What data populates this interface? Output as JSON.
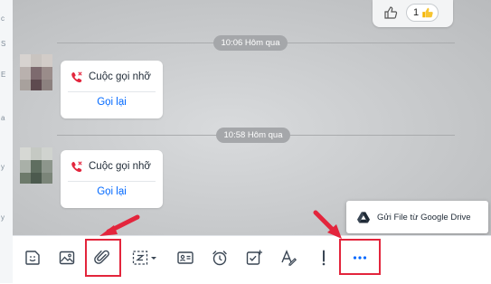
{
  "sidebar": {
    "fragments": [
      "c",
      "S",
      "E",
      "a",
      "y",
      "y"
    ]
  },
  "reaction": {
    "count": "1",
    "icon_outline": "thumbs-up-outline-icon",
    "icon_emoji": "thumbs-up-emoji-icon"
  },
  "timestamps": [
    "10:06 Hôm qua",
    "10:58 Hôm qua"
  ],
  "messages": [
    {
      "type": "missed_call",
      "title": "Cuộc gọi nhỡ",
      "action": "Gọi lại"
    },
    {
      "type": "missed_call",
      "title": "Cuộc gọi nhỡ",
      "action": "Gọi lại"
    }
  ],
  "popup": {
    "label": "Gửi File từ Google Drive",
    "icon": "google-drive-icon"
  },
  "toolbar": {
    "items": [
      "sticker-icon",
      "image-icon",
      "attach-icon",
      "screenshot-icon",
      "contact-card-icon",
      "alarm-icon",
      "task-icon",
      "format-text-icon",
      "important-icon",
      "more-icon"
    ]
  },
  "colors": {
    "accent": "#0068ff",
    "missed_call": "#e3253c",
    "highlight": "#e3253c"
  }
}
